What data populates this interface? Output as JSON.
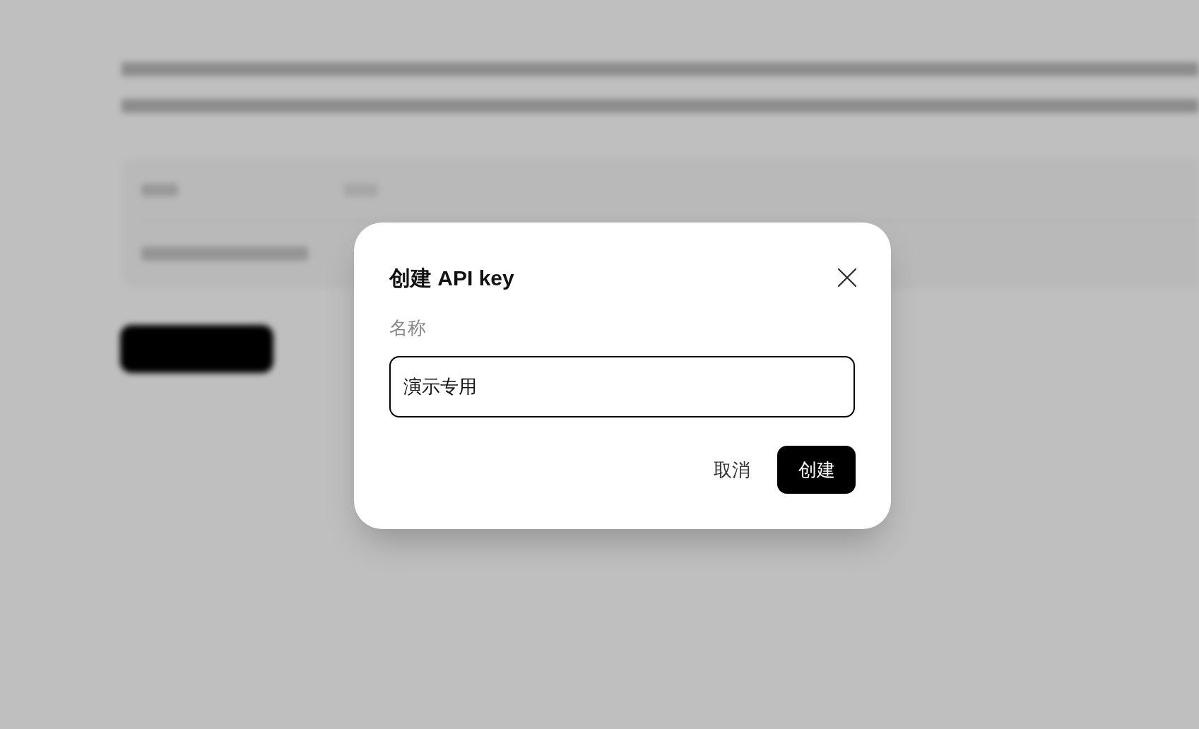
{
  "dialog": {
    "title": "创建 API key",
    "field": {
      "label": "名称",
      "value": "演示专用"
    },
    "buttons": [
      {
        "kind": "secondary",
        "label": "取消"
      },
      {
        "kind": "primary",
        "label": "创建"
      }
    ]
  }
}
